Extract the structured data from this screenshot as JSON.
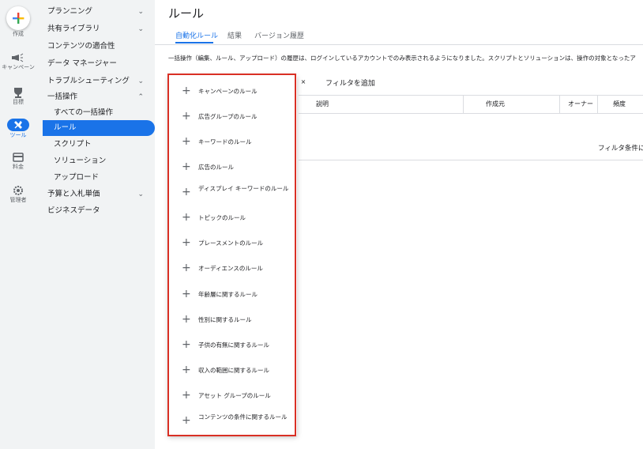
{
  "rail": {
    "create": "作成",
    "campaigns": "キャンペーン",
    "goals": "目標",
    "tools": "ツール",
    "billing": "料金",
    "admin": "管理者"
  },
  "nav": {
    "planning": "プランニング",
    "shared_library": "共有ライブラリ",
    "content_suitability": "コンテンツの適合性",
    "data_manager": "データ マネージャー",
    "troubleshooting": "トラブルシューティング",
    "bulk_actions": "一括操作",
    "all_bulk_actions": "すべての一括操作",
    "rules": "ルール",
    "scripts": "スクリプト",
    "solutions": "ソリューション",
    "uploads": "アップロード",
    "budgets_bids": "予算と入札単価",
    "business_data": "ビジネスデータ"
  },
  "page_title": "ルール",
  "tabs": [
    "自動化ルール",
    "結果",
    "バージョン履歴"
  ],
  "notice": "一括操作（編集、ルール、アップロード）の履歴は、ログインしているアカウントでのみ表示されるようになりました。スクリプトとソリューションは、操作の対象となったア",
  "filter": {
    "add_label": "フィルタを追加",
    "clear_symbol": "×"
  },
  "table": {
    "headers": [
      "説明",
      "作成元",
      "オーナー",
      "頻度"
    ],
    "empty_text": "フィルタ条件に"
  },
  "menu": {
    "items": [
      "キャンペーンのルール",
      "広告グループのルール",
      "キーワードのルール",
      "広告のルール",
      "ディスプレイ キーワードのルール",
      "トピックのルール",
      "プレースメントのルール",
      "オーディエンスのルール",
      "年齢層に関するルール",
      "性別に関するルール",
      "子供の有無に関するルール",
      "収入の範囲に関するルール",
      "アセット グループのルール",
      "コンテンツの条件に関するルール"
    ],
    "plus_symbol": "+"
  },
  "colors": {
    "accent": "#1a73e8",
    "highlight": "#d93025",
    "rail_bg": "#f1f3f4"
  }
}
